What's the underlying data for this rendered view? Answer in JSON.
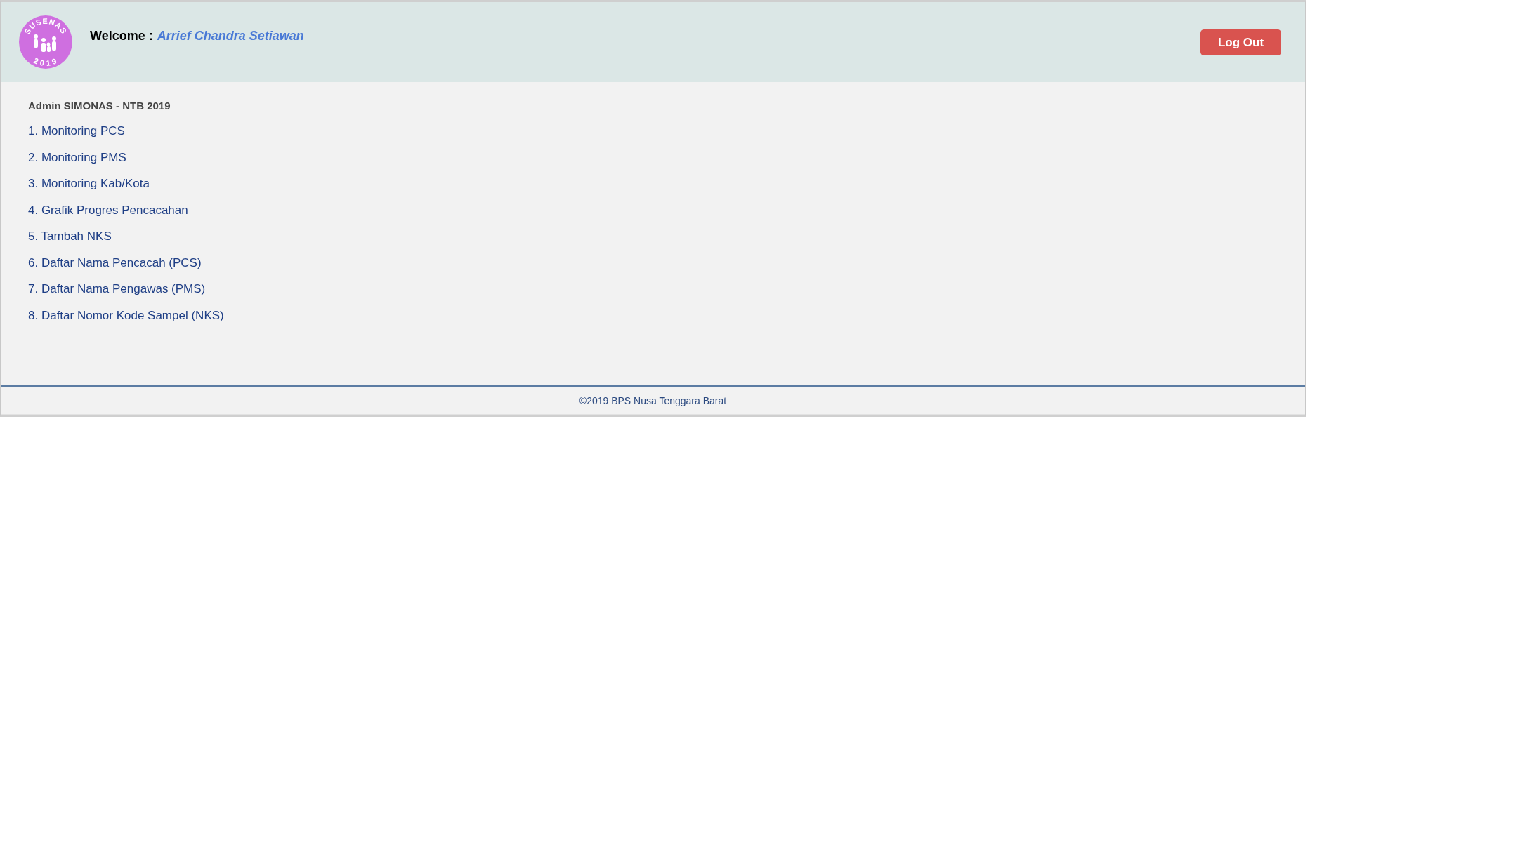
{
  "header": {
    "logo": {
      "top_text": "SUSENAS",
      "bottom_text": "2019"
    },
    "welcome_label": "Welcome :",
    "user_name": "Arrief Chandra Setiawan",
    "logout_button": "Log Out"
  },
  "menu": {
    "title": "Admin SIMONAS - NTB 2019",
    "items": [
      {
        "label": "1. Monitoring PCS"
      },
      {
        "label": "2. Monitoring PMS"
      },
      {
        "label": "3. Monitoring Kab/Kota"
      },
      {
        "label": "4. Grafik Progres Pencacahan"
      },
      {
        "label": "5. Tambah NKS"
      },
      {
        "label": "6. Daftar Nama Pencacah (PCS)"
      },
      {
        "label": "7. Daftar Nama Pengawas (PMS)"
      },
      {
        "label": "8. Daftar Nomor Kode Sampel (NKS)"
      }
    ]
  },
  "footer": {
    "text": "©2019 BPS Nusa Tenggara Barat"
  }
}
